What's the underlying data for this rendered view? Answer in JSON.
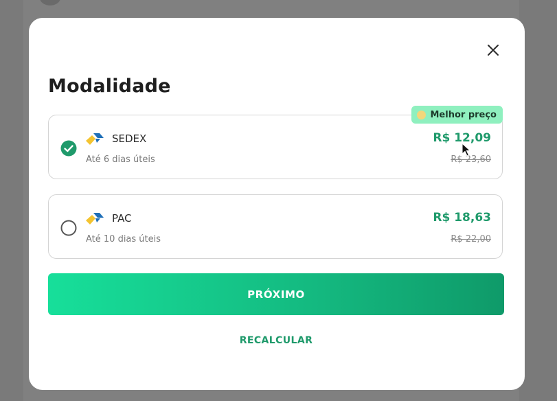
{
  "modal": {
    "title": "Modalidade",
    "close_icon": "close-icon"
  },
  "options": [
    {
      "carrier": "SEDEX",
      "delivery": "Até 6 dias úteis",
      "price": "R$ 12,09",
      "old_price": "R$ 23,60",
      "selected": true,
      "badge": "Melhor preço"
    },
    {
      "carrier": "PAC",
      "delivery": "Até 10 dias úteis",
      "price": "R$ 18,63",
      "old_price": "R$ 22,00",
      "selected": false
    }
  ],
  "actions": {
    "next_label": "PRÓXIMO",
    "recalc_label": "RECALCULAR"
  },
  "colors": {
    "accent": "#1f9a6b",
    "badge_bg": "#8ff0bf",
    "button_gradient_start": "#17df9a",
    "button_gradient_end": "#0f9a69"
  }
}
